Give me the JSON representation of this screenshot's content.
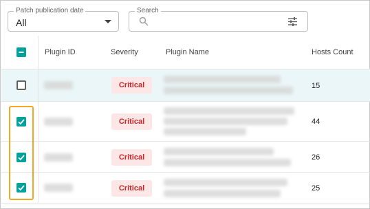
{
  "filters": {
    "date_label": "Patch publication date",
    "date_value": "All",
    "search_label": "Search",
    "search_placeholder": ""
  },
  "table": {
    "columns": {
      "plugin_id": "Plugin ID",
      "severity": "Severity",
      "plugin_name": "Plugin Name",
      "hosts_count": "Hosts Count"
    },
    "header_checkbox": "indeterminate",
    "rows": [
      {
        "checked": false,
        "severity": "Critical",
        "hosts_count": "15"
      },
      {
        "checked": true,
        "severity": "Critical",
        "hosts_count": "44"
      },
      {
        "checked": true,
        "severity": "Critical",
        "hosts_count": "26"
      },
      {
        "checked": true,
        "severity": "Critical",
        "hosts_count": "25"
      }
    ]
  },
  "colors": {
    "accent": "#00a19a",
    "critical_bg": "#fde6e6",
    "critical_text": "#c62828",
    "selection_highlight": "#f5a623",
    "hover_row": "#eaf6f7"
  },
  "icons": {
    "dropdown": "caret-down-icon",
    "search": "search-icon",
    "filter": "tune-icon"
  }
}
